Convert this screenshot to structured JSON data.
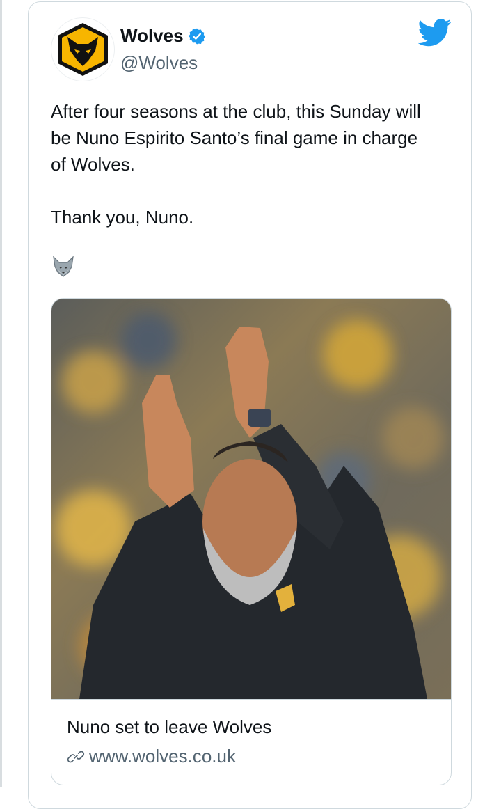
{
  "account": {
    "name": "Wolves",
    "handle": "@Wolves"
  },
  "tweet": {
    "line1": "After four seasons at the club, this Sunday will",
    "line2": "be Nuno Espirito Santo’s final game in charge",
    "line3": "of Wolves.",
    "line4": "Thank you, Nuno."
  },
  "card": {
    "title": "Nuno set to leave Wolves",
    "url": "www.wolves.co.uk"
  },
  "icons": {
    "avatar": "wolves-crest-icon",
    "verified": "verified-badge-icon",
    "brand": "twitter-bird-icon",
    "emoji": "wolf-emoji-icon",
    "link": "link-icon"
  },
  "colors": {
    "accent": "#1d9bf0",
    "crest_gold": "#f7b500",
    "text": "#0f1419",
    "muted": "#536471",
    "border": "#cfd9de"
  }
}
